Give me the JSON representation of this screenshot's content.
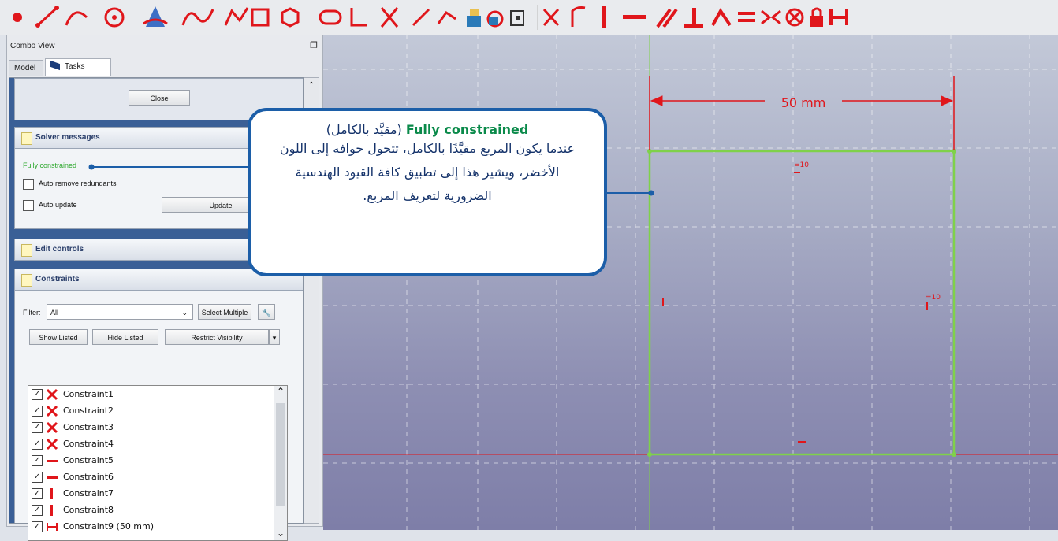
{
  "toolbar": {
    "icons": [
      "point-icon",
      "line-icon",
      "arc-icon",
      "circle-icon",
      "conic-icon",
      "bspline-icon",
      "polyline-icon",
      "rectangle-icon",
      "polygon-icon",
      "slot-icon",
      "fillet-icon",
      "trim-icon",
      "extend-icon",
      "external-geometry-icon",
      "carbon-copy-icon",
      "construction-mode-icon",
      "toggle-mode-icon",
      "coincident-icon",
      "point-on-object-icon",
      "vertical-icon",
      "horizontal-icon",
      "parallel-icon",
      "perpendicular-icon",
      "tangent-icon",
      "equal-icon",
      "symmetric-icon",
      "block-icon",
      "lock-icon",
      "horizontal-distance-icon"
    ]
  },
  "combo": {
    "title": "Combo View",
    "tabs": [
      {
        "label": "Model"
      },
      {
        "label": "Tasks"
      }
    ],
    "close_button": "Close",
    "solver": {
      "header": "Solver messages",
      "status": "Fully constrained",
      "auto_remove": "Auto remove redundants",
      "auto_update": "Auto update",
      "update_button": "Update"
    },
    "edit_controls": {
      "header": "Edit controls"
    },
    "constraints": {
      "header": "Constraints",
      "filter_label": "Filter:",
      "filter_value": "All",
      "select_multiple": "Select Multiple",
      "show_listed": "Show Listed",
      "hide_listed": "Hide Listed",
      "restrict_visibility": "Restrict Visibility",
      "items": [
        {
          "label": "Constraint1",
          "icon": "coincident-icon"
        },
        {
          "label": "Constraint2",
          "icon": "coincident-icon"
        },
        {
          "label": "Constraint3",
          "icon": "coincident-icon"
        },
        {
          "label": "Constraint4",
          "icon": "coincident-icon"
        },
        {
          "label": "Constraint5",
          "icon": "horizontal-icon"
        },
        {
          "label": "Constraint6",
          "icon": "horizontal-icon"
        },
        {
          "label": "Constraint7",
          "icon": "vertical-icon"
        },
        {
          "label": "Constraint8",
          "icon": "vertical-icon"
        },
        {
          "label": "Constraint9 (50 mm)",
          "icon": "horizontal-distance-icon"
        }
      ]
    }
  },
  "viewport": {
    "dimension_label": "50 mm",
    "equal_mark_top": "=10",
    "equal_mark_right": "=10",
    "colors": {
      "constrained": "#7fd14a",
      "constraint": "#e0161b",
      "grid": "#ffffff"
    }
  },
  "callout": {
    "title_en": "Fully constrained",
    "title_ar": "(مقيَّد بالكامل)",
    "body": "عندما يكون المربع مقيَّدًا بالكامل، تتحول حوافه إلى اللون الأخضر، ويشير هذا إلى تطبيق كافة القيود الهندسية الضرورية لتعريف المربع."
  }
}
